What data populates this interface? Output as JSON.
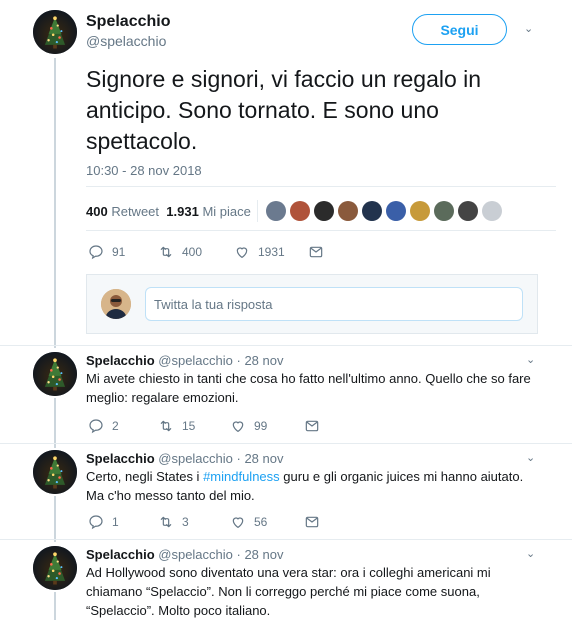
{
  "main_tweet": {
    "name": "Spelacchio",
    "handle": "@spelacchio",
    "follow_label": "Segui",
    "text": "Signore e signori, vi faccio un regalo in anticipo. Sono tornato. E sono uno spettacolo.",
    "timestamp": "10:30 - 28 nov 2018",
    "retweet_count": "400",
    "retweet_label": "Retweet",
    "like_count": "1.931",
    "like_label": "Mi piace",
    "liker_avatar_colors": [
      "#6b7a8f",
      "#b0533a",
      "#2b2b2b",
      "#8a5a3c",
      "#22334d",
      "#3a5fa8",
      "#c79a3a",
      "#5b6b5b",
      "#444444",
      "#c9ced4"
    ],
    "actions": {
      "replies": "91",
      "retweets": "400",
      "likes": "1931"
    }
  },
  "reply_composer": {
    "placeholder": "Twitta la tua risposta"
  },
  "replies": [
    {
      "name": "Spelacchio",
      "meta": "@spelacchio · 28 nov",
      "text": "Mi avete chiesto in tanti che cosa ho fatto nell'ultimo anno. Quello che so fare meglio: regalare emozioni.",
      "replies": "2",
      "retweets": "15",
      "likes": "99"
    },
    {
      "name": "Spelacchio",
      "meta": "@spelacchio · 28 nov",
      "text_before": "Certo, negli States i ",
      "hashtag": "#mindfulness",
      "text_after": " guru e gli organic juices mi hanno aiutato. Ma c'ho messo tanto del mio.",
      "replies": "1",
      "retweets": "3",
      "likes": "56"
    },
    {
      "name": "Spelacchio",
      "meta": "@spelacchio · 28 nov",
      "text": "Ad Hollywood sono diventato una vera star: ora i colleghi americani mi chiamano “Spelaccio”. Non li correggo perché mi piace come suona, “Spelaccio”. Molto poco italiano."
    }
  ],
  "colors": {
    "accent": "#1da1f2",
    "secondary_text": "#657786",
    "border": "#e6ecf0"
  },
  "icons": [
    "tree-avatar-icon",
    "chevron-down-icon",
    "reply-icon",
    "retweet-icon",
    "like-icon",
    "message-icon"
  ]
}
